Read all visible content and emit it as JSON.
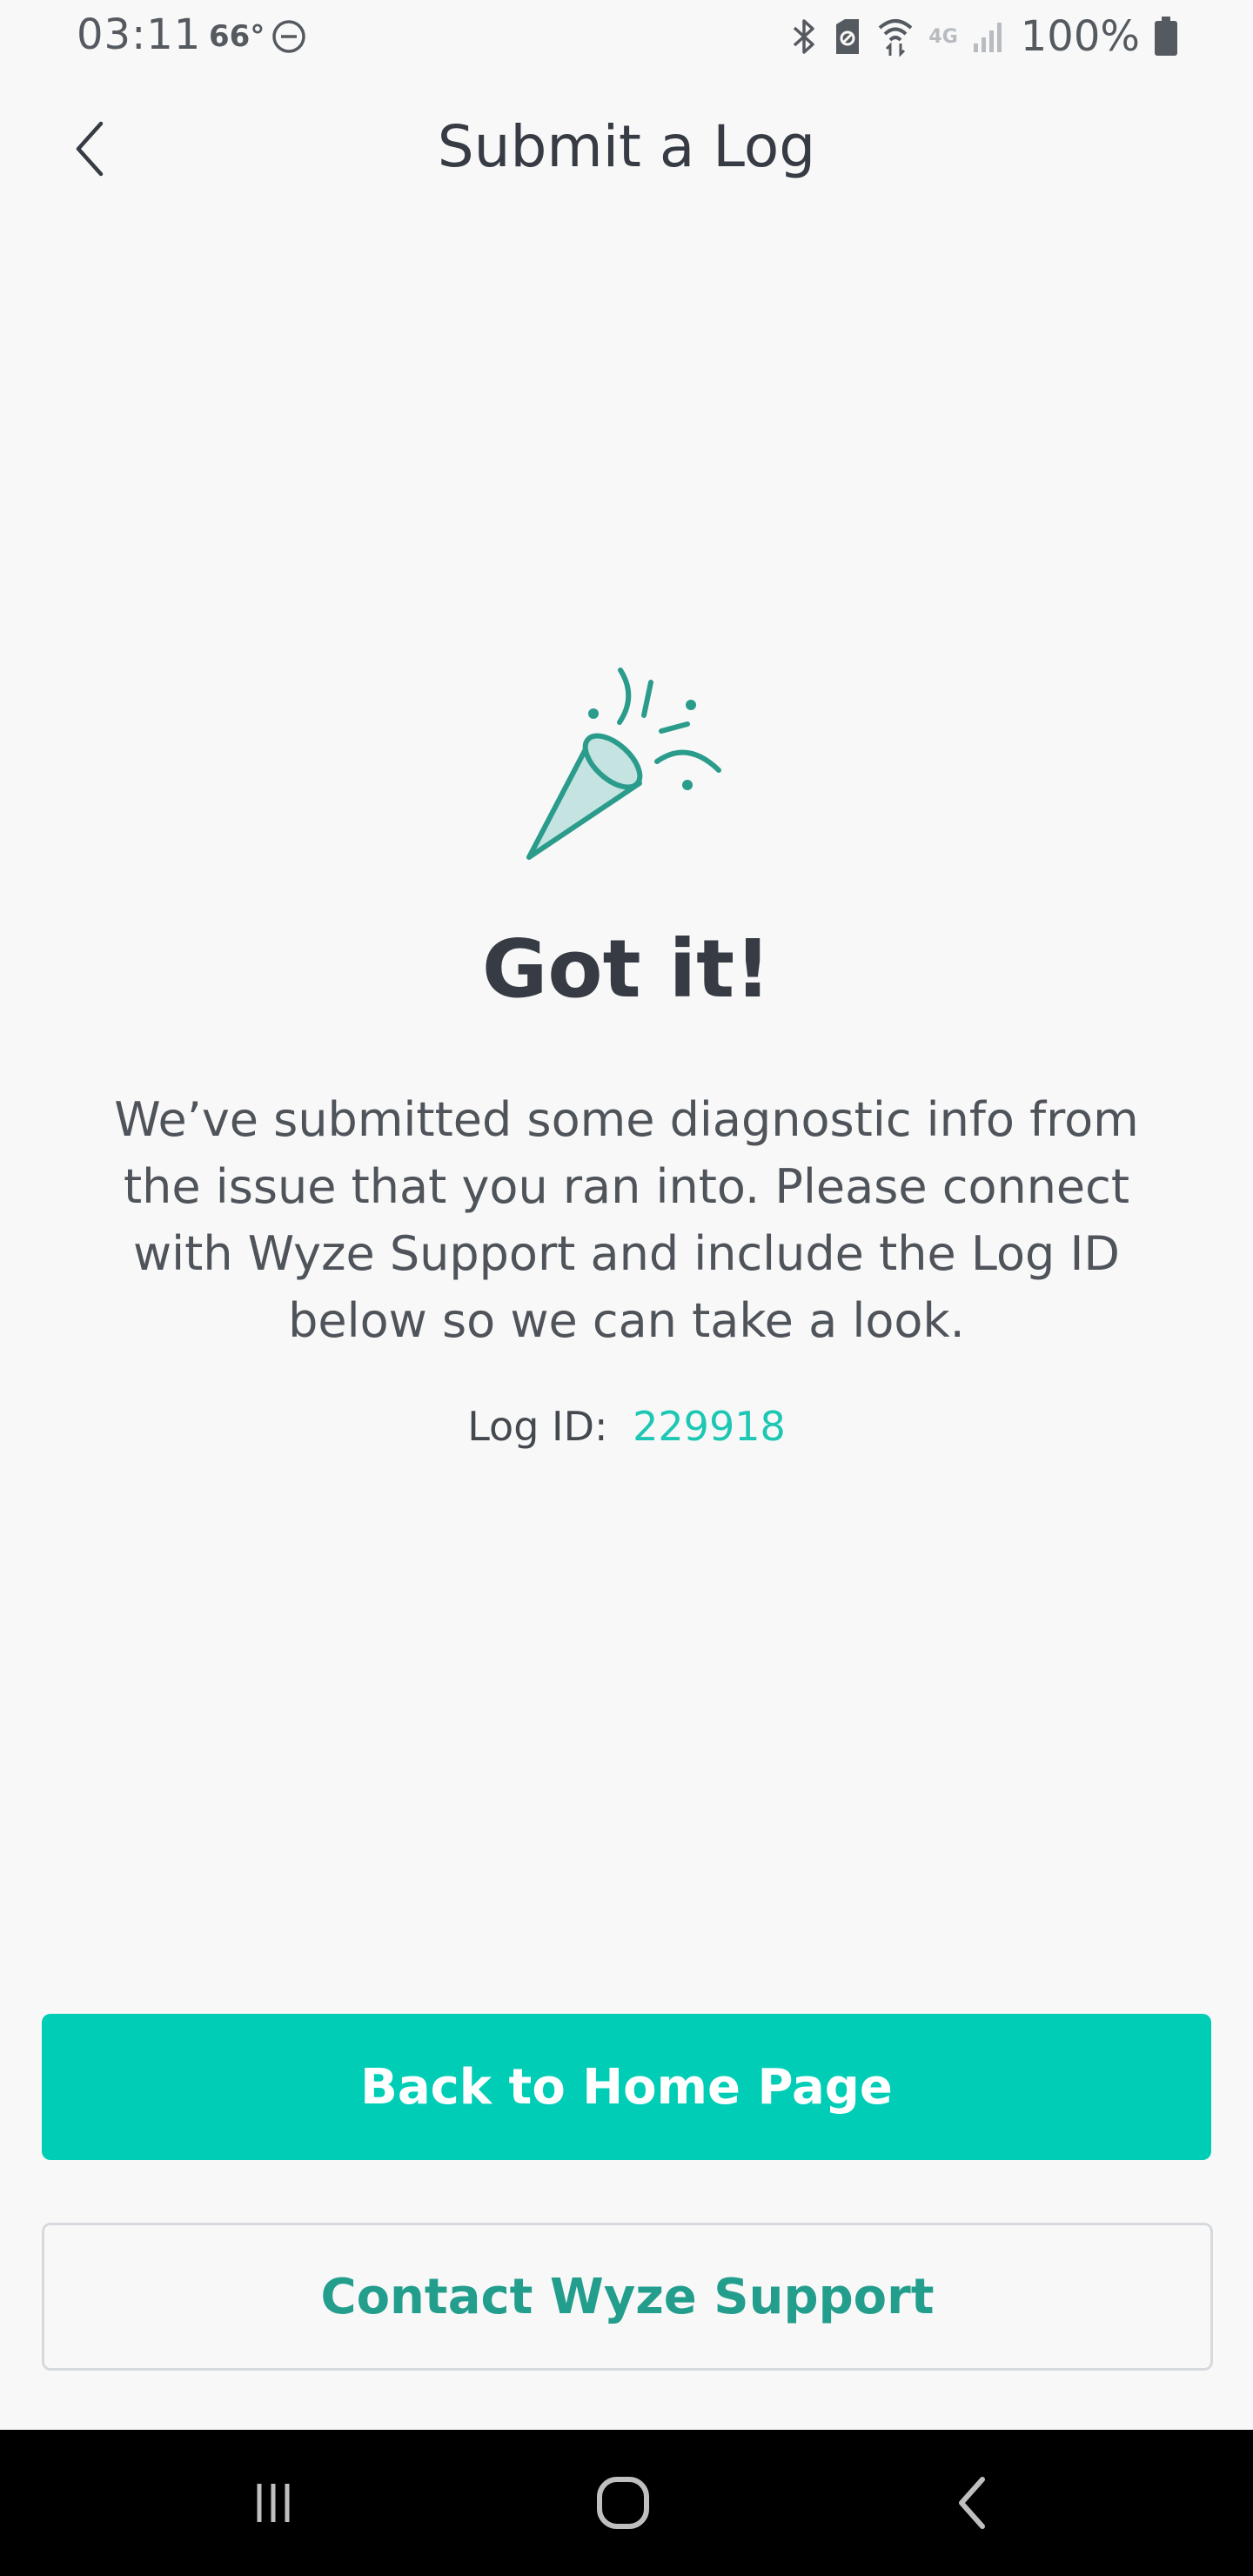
{
  "status_bar": {
    "time": "03:11",
    "temperature": "66°",
    "network": "4G",
    "battery": "100%"
  },
  "header": {
    "title": "Submit a Log"
  },
  "main": {
    "headline": "Got it!",
    "description": "We’ve submitted some diagnostic info from the issue that you ran into. Please connect with Wyze Support and include the Log ID below so we can take a look.",
    "log_id_label": "Log ID:",
    "log_id_value": "229918"
  },
  "actions": {
    "primary_label": "Back to Home Page",
    "secondary_label": "Contact Wyze Support"
  },
  "colors": {
    "accent": "#00cdb6",
    "accent_text": "#239e8d",
    "text_dark": "#363b44"
  }
}
